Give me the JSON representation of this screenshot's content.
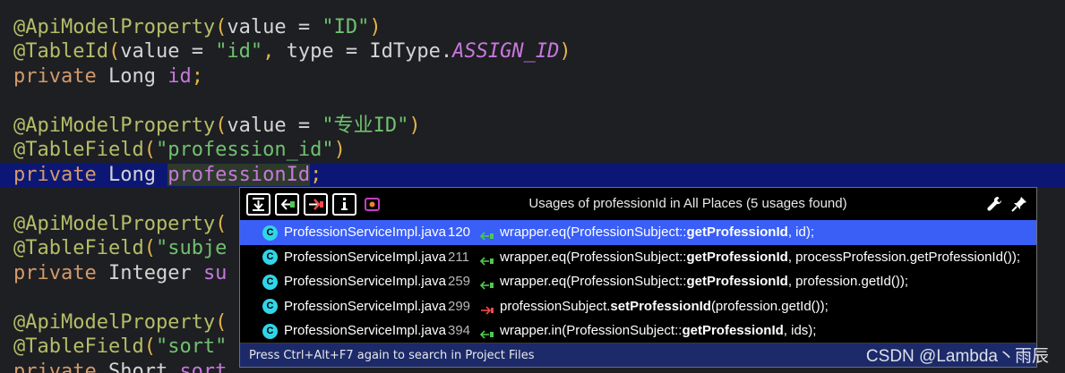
{
  "editor": {
    "lines": [
      {
        "tokens": [
          [
            "t-ann",
            "@ApiModelProperty"
          ],
          [
            "t-paren",
            "("
          ],
          [
            "t-plain",
            "value = "
          ],
          [
            "t-str",
            "\"ID\""
          ],
          [
            "t-paren",
            ")"
          ]
        ]
      },
      {
        "tokens": [
          [
            "t-ann",
            "@TableId"
          ],
          [
            "t-paren",
            "("
          ],
          [
            "t-plain",
            "value = "
          ],
          [
            "t-str",
            "\"id\""
          ],
          [
            "t-semi",
            ","
          ],
          [
            "t-plain",
            " type = IdType."
          ],
          [
            "t-const",
            "ASSIGN_ID"
          ],
          [
            "t-paren",
            ")"
          ]
        ]
      },
      {
        "tokens": [
          [
            "t-kw",
            "private"
          ],
          [
            "t-plain",
            " Long "
          ],
          [
            "t-field",
            "id"
          ],
          [
            "t-semi",
            ";"
          ]
        ]
      },
      {
        "tokens": []
      },
      {
        "tokens": [
          [
            "t-ann",
            "@ApiModelProperty"
          ],
          [
            "t-paren",
            "("
          ],
          [
            "t-plain",
            "value = "
          ],
          [
            "t-str",
            "\"专业ID\""
          ],
          [
            "t-paren",
            ")"
          ]
        ]
      },
      {
        "tokens": [
          [
            "t-ann",
            "@TableField"
          ],
          [
            "t-paren",
            "("
          ],
          [
            "t-str",
            "\"profession_id\""
          ],
          [
            "t-paren",
            ")"
          ]
        ]
      },
      {
        "tokens": [
          [
            "t-kw",
            "private"
          ],
          [
            "t-plain",
            " Long "
          ],
          [
            "t-field t-hl",
            "professionId"
          ],
          [
            "t-semi",
            ";"
          ]
        ],
        "current": true
      },
      {
        "tokens": []
      },
      {
        "tokens": [
          [
            "t-ann",
            "@ApiModelProperty"
          ],
          [
            "t-paren",
            "("
          ]
        ]
      },
      {
        "tokens": [
          [
            "t-ann",
            "@TableField"
          ],
          [
            "t-paren",
            "("
          ],
          [
            "t-str",
            "\"subje"
          ]
        ]
      },
      {
        "tokens": [
          [
            "t-kw",
            "private"
          ],
          [
            "t-plain",
            " Integer "
          ],
          [
            "t-field",
            "su"
          ]
        ]
      },
      {
        "tokens": []
      },
      {
        "tokens": [
          [
            "t-ann",
            "@ApiModelProperty"
          ],
          [
            "t-paren",
            "("
          ]
        ]
      },
      {
        "tokens": [
          [
            "t-ann",
            "@TableField"
          ],
          [
            "t-paren",
            "("
          ],
          [
            "t-str",
            "\"sort\""
          ]
        ]
      },
      {
        "tokens": [
          [
            "t-kw",
            "private"
          ],
          [
            "t-plain",
            " Short "
          ],
          [
            "t-field",
            "sort"
          ]
        ]
      }
    ]
  },
  "popup": {
    "title": "Usages of professionId in All Places (5 usages found)",
    "toolbar": {
      "icons": [
        "merge-usages-icon",
        "read-access-icon",
        "write-access-icon",
        "info-icon",
        "module-icon"
      ],
      "right_icons": [
        "settings-wrench-icon",
        "pin-icon"
      ]
    },
    "usages": [
      {
        "file": "ProfessionServiceImpl.java",
        "line": "120",
        "kind": "read",
        "pre": "wrapper.eq(ProfessionSubject::",
        "method": "getProfessionId",
        "post": ", id);",
        "selected": true
      },
      {
        "file": "ProfessionServiceImpl.java",
        "line": "211",
        "kind": "read",
        "pre": "wrapper.eq(ProfessionSubject::",
        "method": "getProfessionId",
        "post": ", processProfession.getProfessionId());"
      },
      {
        "file": "ProfessionServiceImpl.java",
        "line": "259",
        "kind": "read",
        "pre": "wrapper.eq(ProfessionSubject::",
        "method": "getProfessionId",
        "post": ", profession.getId());"
      },
      {
        "file": "ProfessionServiceImpl.java",
        "line": "299",
        "kind": "write",
        "pre": "professionSubject.",
        "method": "setProfessionId",
        "post": "(profession.getId());"
      },
      {
        "file": "ProfessionServiceImpl.java",
        "line": "394",
        "kind": "read",
        "pre": "wrapper.in(ProfessionSubject::",
        "method": "getProfessionId",
        "post": ", ids);"
      }
    ],
    "class_icon_letter": "C",
    "footer": "Press Ctrl+Alt+F7 again to search in Project Files"
  },
  "watermark": "CSDN @Lambda丶雨辰",
  "colors": {
    "read_arrow": "#4ec94e",
    "write_arrow": "#f04a4a",
    "selection": "#3a5ff7",
    "current_line": "#0c1775"
  }
}
